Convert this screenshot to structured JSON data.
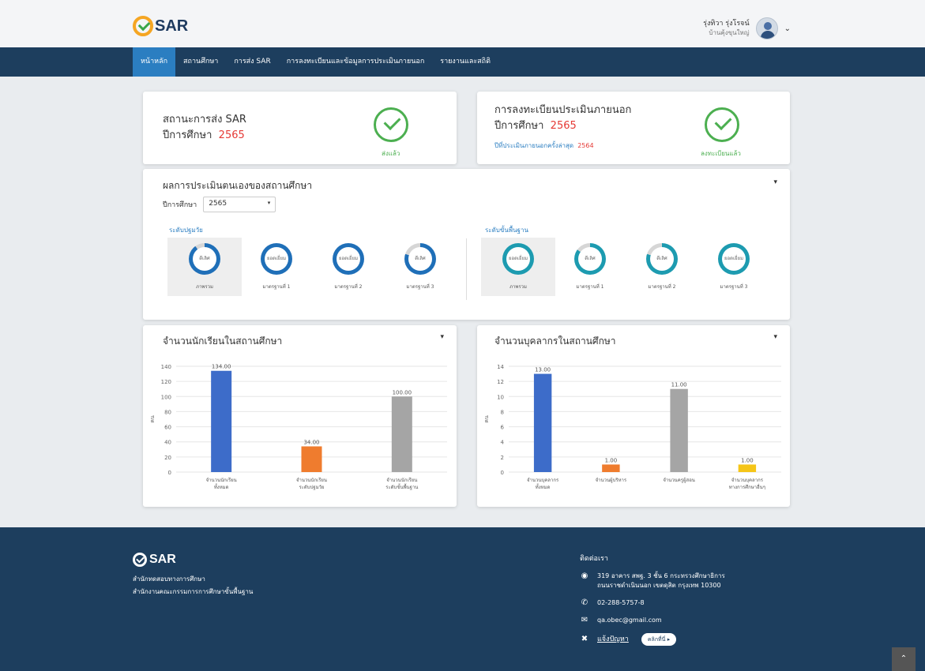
{
  "header": {
    "logo_text": "SAR",
    "user_name": "รุ่งทิวา รุ่งโรจน์",
    "user_role": "บ้านคุ้งขุนใหญ่"
  },
  "nav": {
    "items": [
      "หน้าหลัก",
      "สถานศึกษา",
      "การส่ง SAR",
      "การลงทะเบียนและข้อมูลการประเมินภายนอก",
      "รายงานและสถิติ"
    ]
  },
  "sar_status": {
    "title": "สถานะการส่ง SAR",
    "year_label": "ปีการศึกษา",
    "year": "2565",
    "status": "ส่งแล้ว"
  },
  "external_eval": {
    "title": "การลงทะเบียนประเมินภายนอก",
    "year_label": "ปีการศึกษา",
    "year": "2565",
    "last_eval_label": "ปีที่ประเมินภายนอกครั้งล่าสุด",
    "last_eval_year": "2564",
    "status": "ลงทะเบียนแล้ว"
  },
  "self_assessment": {
    "title": "ผลการประเมินตนเองของสถานศึกษา",
    "year_label": "ปีการศึกษา",
    "year_selected": "2565",
    "early_childhood": {
      "title": "ระดับปฐมวัย",
      "items": [
        {
          "label": "ภาพรวม",
          "value": "ดีเลิศ",
          "fraction": 0.9
        },
        {
          "label": "มาตรฐานที่ 1",
          "value": "ยอดเยี่ยม",
          "fraction": 1.0
        },
        {
          "label": "มาตรฐานที่ 2",
          "value": "ยอดเยี่ยม",
          "fraction": 1.0
        },
        {
          "label": "มาตรฐานที่ 3",
          "value": "ดีเลิศ",
          "fraction": 0.8
        }
      ]
    },
    "basic": {
      "title": "ระดับขั้นพื้นฐาน",
      "items": [
        {
          "label": "ภาพรวม",
          "value": "ยอดเยี่ยม",
          "fraction": 1.0
        },
        {
          "label": "มาตรฐานที่ 1",
          "value": "ดีเลิศ",
          "fraction": 0.85
        },
        {
          "label": "มาตรฐานที่ 2",
          "value": "ดีเลิศ",
          "fraction": 0.8
        },
        {
          "label": "มาตรฐานที่ 3",
          "value": "ยอดเยี่ยม",
          "fraction": 1.0
        }
      ]
    }
  },
  "chart_data": [
    {
      "type": "bar",
      "title": "จำนวนนักเรียนในสถานศึกษา",
      "ylabel": "คน",
      "ylim": [
        0,
        140
      ],
      "yticks": [
        0,
        20,
        40,
        60,
        80,
        100,
        120,
        140
      ],
      "categories": [
        [
          "จำนวนนักเรียน",
          "ทั้งหมด"
        ],
        [
          "จำนวนนักเรียน",
          "ระดับปฐมวัย"
        ],
        [
          "จำนวนนักเรียน",
          "ระดับขั้นพื้นฐาน"
        ]
      ],
      "values": [
        134,
        34,
        100
      ],
      "value_labels": [
        "134.00",
        "34.00",
        "100.00"
      ],
      "colors": [
        "#3d6cc9",
        "#ef7c2e",
        "#a5a5a5"
      ]
    },
    {
      "type": "bar",
      "title": "จำนวนบุคลากรในสถานศึกษา",
      "ylabel": "คน",
      "ylim": [
        0,
        14
      ],
      "yticks": [
        0,
        2,
        4,
        6,
        8,
        10,
        12,
        14
      ],
      "categories": [
        [
          "จำนวนบุคลากร",
          "ทั้งหมด"
        ],
        [
          "จำนวนผู้บริหาร"
        ],
        [
          "จำนวนครูผู้สอน"
        ],
        [
          "จำนวนบุคลากร",
          "ทางการศึกษาอื่นๆ"
        ]
      ],
      "values": [
        13,
        1,
        11,
        1
      ],
      "value_labels": [
        "13.00",
        "1.00",
        "11.00",
        "1.00"
      ],
      "colors": [
        "#3d6cc9",
        "#ef7c2e",
        "#a5a5a5",
        "#f5c518"
      ]
    }
  ],
  "footer": {
    "logo_text": "SAR",
    "org1": "สำนักทดสอบทางการศึกษา",
    "org2": "สำนักงานคณะกรรมการการศึกษาขั้นพื้นฐาน",
    "contact_title": "ติดต่อเรา",
    "address1": "319 อาคาร สพฐ. 3 ชั้น 6 กระทรวงศึกษาธิการ",
    "address2": "ถนนราชดำเนินนอก เขตดุสิต กรุงเทพ 10300",
    "phone": "02-288-5757-8",
    "email": "qa.obec@gmail.com",
    "report_label": "แจ้งปัญหา",
    "report_button": "คลิกที่นี่"
  },
  "colors": {
    "navy": "#1d3e5e",
    "active_nav": "#2b7ec1",
    "success": "#4caf50",
    "ring_early": "#1f6fb8",
    "ring_basic": "#1d9bb0"
  }
}
